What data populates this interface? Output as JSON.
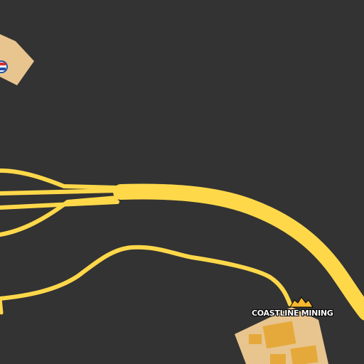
{
  "map": {
    "background_color": "#333333",
    "road_color": "#ffd84a",
    "building_color": "#e8c58e",
    "building_shade_color": "#e5a93b",
    "poi": {
      "label": "COASTLINE MINING",
      "icon": "mine-icon",
      "icon_color": "#f5b82e"
    },
    "partial_marker": {
      "icon": "flag-badge-icon",
      "colors": [
        "#d32f2f",
        "#ffffff",
        "#1f4fa8"
      ]
    }
  }
}
